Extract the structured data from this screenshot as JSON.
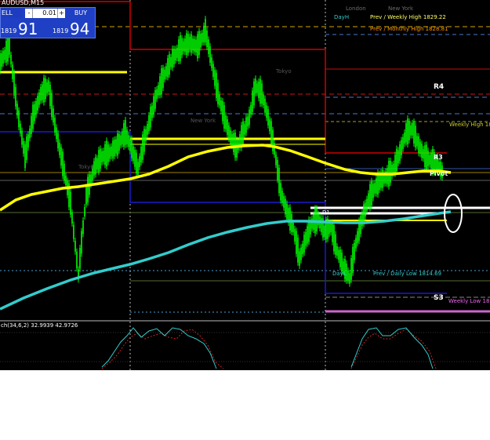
{
  "window": {
    "title": "AUDUSD,M15"
  },
  "trade_panel": {
    "sell_label": "ELL",
    "buy_label": "BUY",
    "lot_minus": "-",
    "lot_value": "0.01",
    "lot_plus": "+",
    "bid_small": "1819",
    "bid_big": "91",
    "ask_small": "1819",
    "ask_big": "94"
  },
  "session_labels": {
    "london": "London",
    "new_york_top": "New York",
    "tokyo": "Tokyo",
    "new_york_mid": "New York",
    "tokyo_left": "Tokyo"
  },
  "levels": {
    "daym_high": "DayH",
    "prev_weekly_high": "Prev / Weekly High 1829.22",
    "prev_monthly_high": "Prev / Monthly High 1828.81",
    "r4": "R4",
    "weekly_high": "Weekly High 18",
    "r3": "R3",
    "pivot": "Pivot",
    "d1": "D1",
    "dayl": "DayL",
    "prev_daily_low": "Prev / Daily Low  1814.69",
    "s3": "S3",
    "weekly_low": "Weekly Low 18"
  },
  "oscillator": {
    "label": "ch(34,6,2) 32.9939 42.9726"
  },
  "colors": {
    "background": "#000000",
    "candle": "#00ff00",
    "ma_yellow": "#ffff00",
    "ma_cyan": "#33cccc",
    "resistance": "#cc0000",
    "support": "#1a1acc",
    "weekly_low": "#cc66cc"
  }
}
